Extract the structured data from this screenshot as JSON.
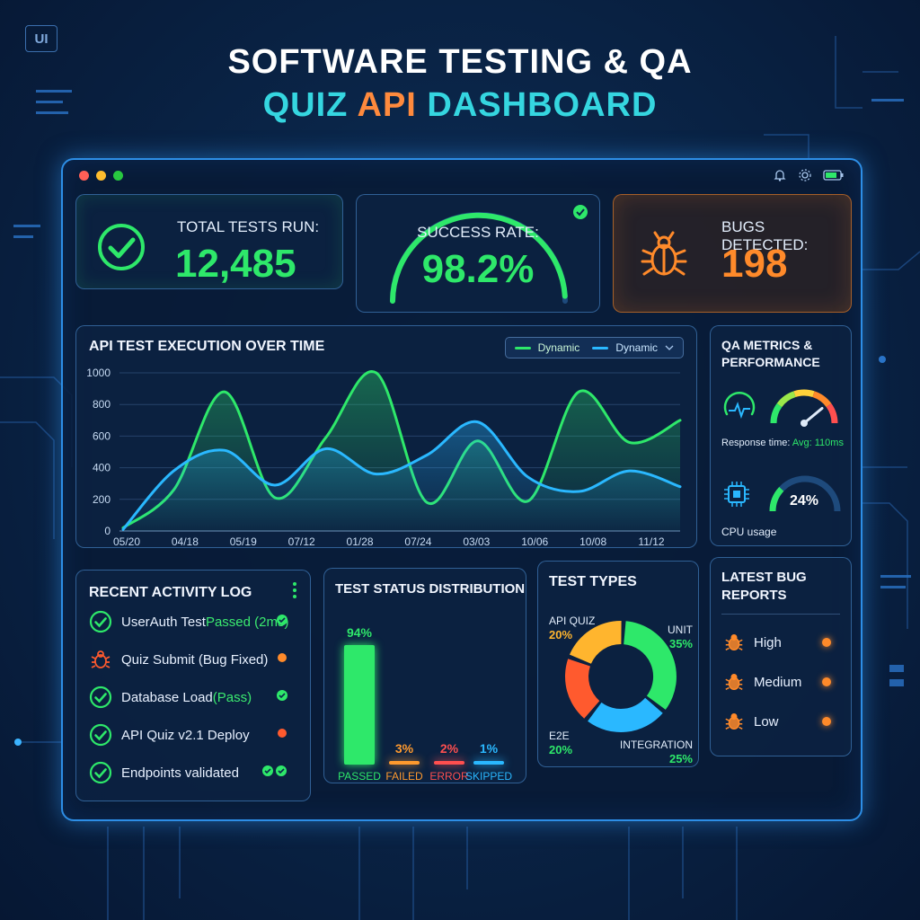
{
  "header": {
    "badge": "UI",
    "title_line1": "SOFTWARE TESTING & QA",
    "title_line2_a": "QUIZ",
    "title_line2_b": "API",
    "title_line2_c": "DASHBOARD"
  },
  "window": {
    "traffic_lights": [
      "#ff5f57",
      "#ffbd2e",
      "#28c840"
    ],
    "icons": [
      "bell-icon",
      "gear-icon",
      "battery-icon"
    ]
  },
  "kpis": {
    "total_tests": {
      "label": "TOTAL TESTS RUN:",
      "value": "12,485",
      "icon": "check-circle-icon",
      "color": "#2ee86a"
    },
    "success_rate": {
      "label": "SUCCESS RATE:",
      "value": "98.2%",
      "gauge_fraction": 0.982,
      "color": "#2ee86a"
    },
    "bugs": {
      "label": "BUGS DETECTED:",
      "value": "198",
      "icon": "bug-icon",
      "color": "#ff8a2a"
    }
  },
  "execution": {
    "title": "API TEST EXECUTION OVER TIME",
    "legend": [
      {
        "name": "Dynamic",
        "color": "#2ee86a"
      },
      {
        "name": "Dynamic",
        "color": "#2ab8ff"
      }
    ],
    "chart_data": {
      "type": "line",
      "x": [
        "05/20",
        "04/18",
        "05/19",
        "07/12",
        "01/28",
        "07/24",
        "03/03",
        "10/06",
        "10/08",
        "11/12"
      ],
      "ylim": [
        0,
        1000
      ],
      "yticks": [
        0,
        200,
        400,
        600,
        800,
        1000
      ],
      "series": [
        {
          "name": "Dynamic",
          "color": "#2ee86a",
          "values": [
            20,
            260,
            880,
            210,
            590,
            1000,
            180,
            570,
            190,
            880,
            560,
            700
          ]
        },
        {
          "name": "Dynamic",
          "color": "#2ab8ff",
          "values": [
            10,
            380,
            510,
            290,
            520,
            360,
            480,
            690,
            340,
            250,
            380,
            280
          ]
        }
      ]
    }
  },
  "qa_metrics": {
    "title_line1": "QA METRICS &",
    "title_line2": "PERFORMANCE",
    "response_label": "Response time:",
    "response_value": "Avg: 110ms",
    "response_gauge_fraction": 0.78,
    "cpu_value": "24%",
    "cpu_fraction": 0.24,
    "cpu_label": "CPU usage"
  },
  "activity": {
    "title": "RECENT ACTIVITY LOG",
    "items": [
      {
        "text": "UserAuth Test ",
        "status": "Passed (2ms)",
        "icon": "check-circle-icon",
        "kind": "pass"
      },
      {
        "text": "Quiz Submit (Bug Fixed)",
        "status": "",
        "icon": "bug-icon",
        "kind": "bug"
      },
      {
        "text": "Database Load ",
        "status": "(Pass)",
        "icon": "check-circle-icon",
        "kind": "pass"
      },
      {
        "text": "API Quiz v2.1 Deploy",
        "status": "",
        "icon": "check-circle-icon",
        "kind": "deploy"
      },
      {
        "text": "Endpoints validated",
        "status": "",
        "icon": "check-circle-icon",
        "kind": "multi"
      }
    ]
  },
  "status_dist": {
    "title": "TEST STATUS DISTRIBUTION",
    "chart_data": {
      "type": "bar",
      "categories": [
        "PASSED",
        "FAILED",
        "ERROR",
        "SKIPPED"
      ],
      "values": [
        94,
        3,
        2,
        1
      ],
      "labels": [
        "94%",
        "3%",
        "2%",
        "1%"
      ],
      "colors": [
        "#2ee86a",
        "#ff9a2e",
        "#ff4f4f",
        "#2ab8ff"
      ],
      "ylim": [
        0,
        100
      ]
    }
  },
  "test_types": {
    "title": "TEST TYPES",
    "chart_data": {
      "type": "pie",
      "categories": [
        "UNIT",
        "INTEGRATION",
        "E2E",
        "API QUIZ"
      ],
      "values": [
        35,
        25,
        20,
        20
      ],
      "labels": [
        "35%",
        "25%",
        "20%",
        "20%"
      ],
      "colors": [
        "#2ee86a",
        "#2ab8ff",
        "#ff5a2e",
        "#ffb52e"
      ]
    }
  },
  "bugs": {
    "title_line1": "LATEST BUG",
    "title_line2": "REPORTS",
    "items": [
      {
        "label": "High",
        "icon": "bug-icon"
      },
      {
        "label": "Medium",
        "icon": "bug-icon"
      },
      {
        "label": "Low",
        "icon": "bug-icon"
      }
    ]
  }
}
